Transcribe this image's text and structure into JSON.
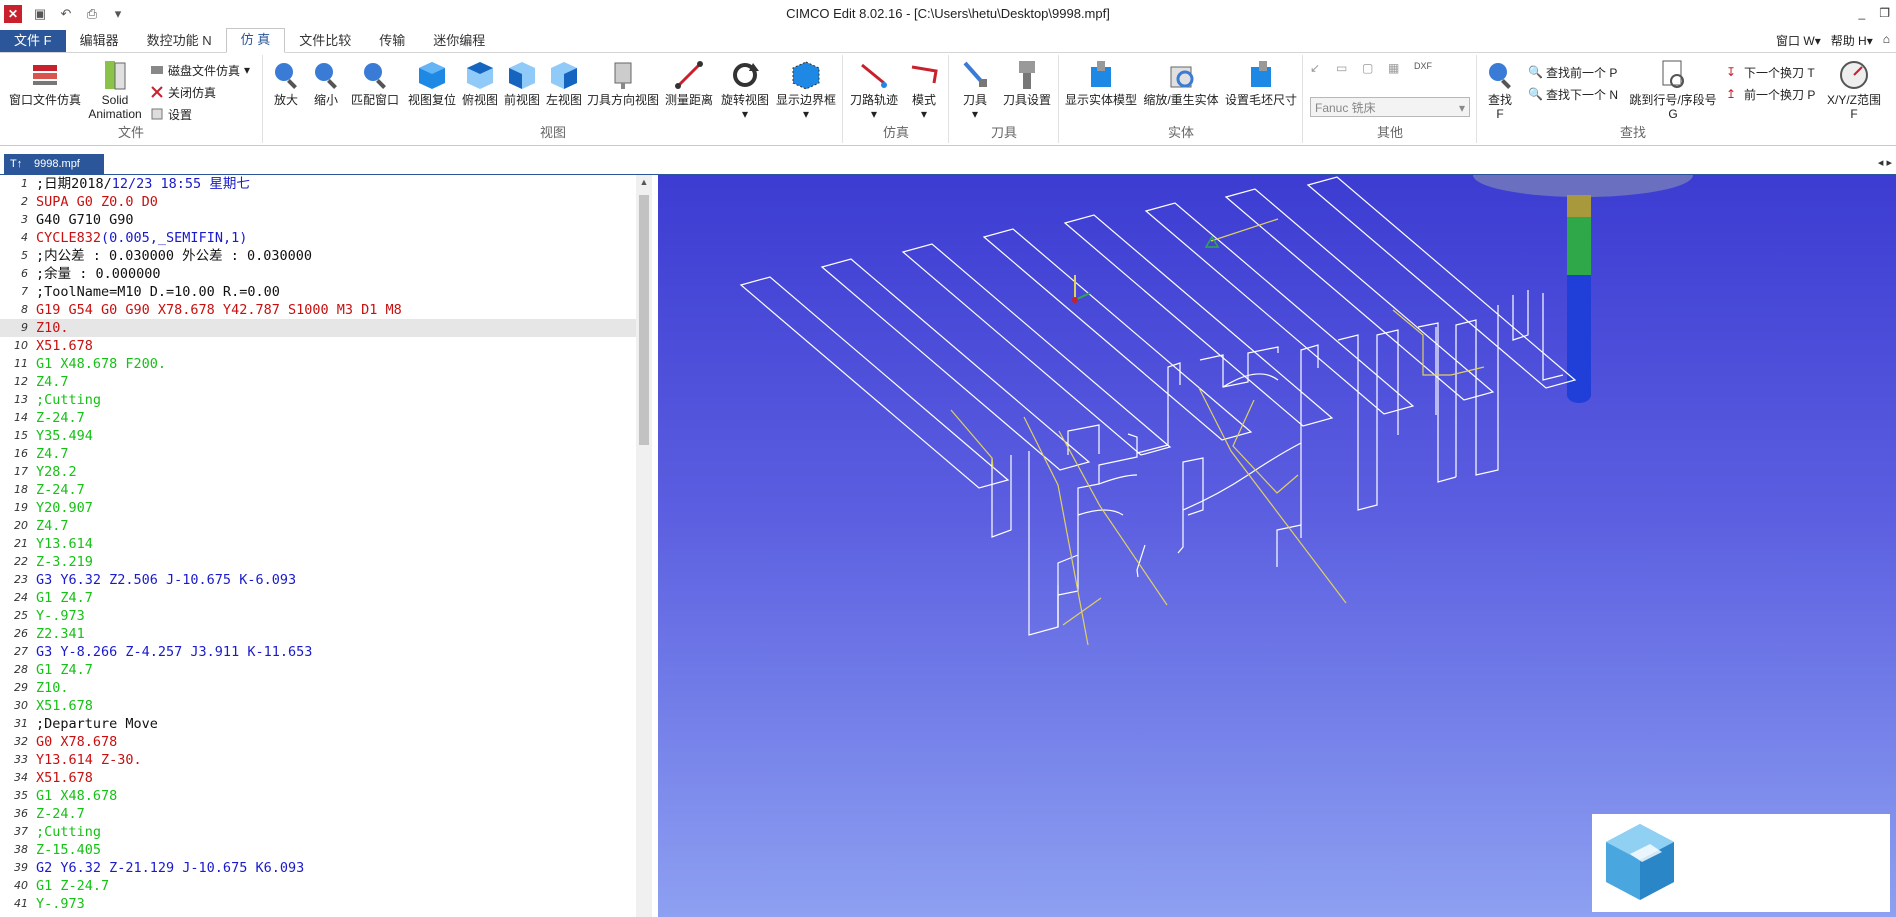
{
  "titlebar": {
    "title": "CIMCO Edit 8.02.16 - [C:\\Users\\hetu\\Desktop\\9998.mpf]",
    "minimize": "_",
    "restore": "❐"
  },
  "menubar": {
    "tabs": [
      "文件 F",
      "编辑器",
      "数控功能 N",
      "仿 真",
      "文件比较",
      "传输",
      "迷你编程"
    ],
    "active_index": 3,
    "right": [
      "窗口 W▾",
      "帮助 H▾",
      "⌂"
    ]
  },
  "ribbon": {
    "file_group": {
      "label": "文件",
      "window_sim": "窗口文件仿真",
      "solid_anim_l1": "Solid",
      "solid_anim_l2": "Animation",
      "disk_sim": "磁盘文件仿真",
      "close_sim": "关闭仿真",
      "settings": "设置"
    },
    "view_group": {
      "label": "视图",
      "buttons": [
        "放大",
        "缩小",
        "匹配窗口",
        "视图复位",
        "俯视图",
        "前视图",
        "左视图",
        "刀具方向视图",
        "测量距离",
        "旋转视图",
        "显示边界框"
      ]
    },
    "sim_group": {
      "label": "仿真",
      "buttons": [
        "刀路轨迹",
        "模式"
      ]
    },
    "tool_group": {
      "label": "刀具",
      "buttons": [
        "刀具",
        "刀具设置"
      ]
    },
    "solid_group": {
      "label": "实体",
      "buttons": [
        "显示实体模型",
        "缩放/重生实体",
        "设置毛坯尺寸"
      ]
    },
    "other_group": {
      "label": "其他",
      "machine_select": "Fanuc 铣床"
    },
    "find_group": {
      "label": "查找",
      "find_l1": "查找",
      "find_l2": "F",
      "find_prev": "查找前一个 P",
      "find_next": "查找下一个 N",
      "jump_l1": "跳到行号/序段号",
      "jump_l2": "G",
      "next_tool": "下一个换刀 T",
      "prev_tool": "前一个换刀 P",
      "xyz_l1": "X/Y/Z范围",
      "xyz_l2": "F"
    }
  },
  "doc_tab": {
    "name": "9998.mpf"
  },
  "editor": {
    "highlight_line": 9,
    "lines": [
      {
        "n": "1",
        "segs": [
          {
            "t": ";日期2018/",
            "c": "black"
          },
          {
            "t": "12/23 18:55 星期七",
            "c": "blue"
          }
        ]
      },
      {
        "n": "2",
        "segs": [
          {
            "t": "SUPA G0 Z0.0 D0",
            "c": "red"
          }
        ]
      },
      {
        "n": "3",
        "segs": [
          {
            "t": "G40 G710 G90",
            "c": "black"
          }
        ]
      },
      {
        "n": "4",
        "segs": [
          {
            "t": "CYCLE832",
            "c": "red"
          },
          {
            "t": "(0.005,_SEMIFIN,1)",
            "c": "blue"
          }
        ]
      },
      {
        "n": "5",
        "segs": [
          {
            "t": ";内公差 : 0.030000 外公差 : 0.030000",
            "c": "black"
          }
        ]
      },
      {
        "n": "6",
        "segs": [
          {
            "t": ";余量 : 0.000000",
            "c": "black"
          }
        ]
      },
      {
        "n": "7",
        "segs": [
          {
            "t": ";ToolName=M10 D.=10.00 R.=0.00",
            "c": "black"
          }
        ]
      },
      {
        "n": "8",
        "segs": [
          {
            "t": "G19 G54 G0 G90 X78.678 Y42.787 S1000 M3 D1 M8",
            "c": "red"
          }
        ]
      },
      {
        "n": "9",
        "segs": [
          {
            "t": "Z10.",
            "c": "red"
          }
        ]
      },
      {
        "n": "10",
        "segs": [
          {
            "t": "X51.678",
            "c": "red"
          }
        ]
      },
      {
        "n": "11",
        "segs": [
          {
            "t": "G1 X48.678 F200.",
            "c": "green"
          }
        ]
      },
      {
        "n": "12",
        "segs": [
          {
            "t": "Z4.7",
            "c": "green"
          }
        ]
      },
      {
        "n": "13",
        "segs": [
          {
            "t": ";Cutting",
            "c": "green"
          }
        ]
      },
      {
        "n": "14",
        "segs": [
          {
            "t": "Z-24.7",
            "c": "green"
          }
        ]
      },
      {
        "n": "15",
        "segs": [
          {
            "t": "Y35.494",
            "c": "green"
          }
        ]
      },
      {
        "n": "16",
        "segs": [
          {
            "t": "Z4.7",
            "c": "green"
          }
        ]
      },
      {
        "n": "17",
        "segs": [
          {
            "t": "Y28.2",
            "c": "green"
          }
        ]
      },
      {
        "n": "18",
        "segs": [
          {
            "t": "Z-24.7",
            "c": "green"
          }
        ]
      },
      {
        "n": "19",
        "segs": [
          {
            "t": "Y20.907",
            "c": "green"
          }
        ]
      },
      {
        "n": "20",
        "segs": [
          {
            "t": "Z4.7",
            "c": "green"
          }
        ]
      },
      {
        "n": "21",
        "segs": [
          {
            "t": "Y13.614",
            "c": "green"
          }
        ]
      },
      {
        "n": "22",
        "segs": [
          {
            "t": "Z-3.219",
            "c": "green"
          }
        ]
      },
      {
        "n": "23",
        "segs": [
          {
            "t": "G3 Y6.32 Z2.506 J-10.675 K-6.093",
            "c": "blue"
          }
        ]
      },
      {
        "n": "24",
        "segs": [
          {
            "t": "G1 Z4.7",
            "c": "green"
          }
        ]
      },
      {
        "n": "25",
        "segs": [
          {
            "t": "Y-.973",
            "c": "green"
          }
        ]
      },
      {
        "n": "26",
        "segs": [
          {
            "t": "Z2.341",
            "c": "green"
          }
        ]
      },
      {
        "n": "27",
        "segs": [
          {
            "t": "G3 Y-8.266 Z-4.257 J3.911 K-11.653",
            "c": "blue"
          }
        ]
      },
      {
        "n": "28",
        "segs": [
          {
            "t": "G1 Z4.7",
            "c": "green"
          }
        ]
      },
      {
        "n": "29",
        "segs": [
          {
            "t": "Z10.",
            "c": "green"
          }
        ]
      },
      {
        "n": "30",
        "segs": [
          {
            "t": "X51.678",
            "c": "green"
          }
        ]
      },
      {
        "n": "31",
        "segs": [
          {
            "t": ";Departure Move",
            "c": "black"
          }
        ]
      },
      {
        "n": "32",
        "segs": [
          {
            "t": "G0 X78.678",
            "c": "red"
          }
        ]
      },
      {
        "n": "33",
        "segs": [
          {
            "t": "Y13.614 Z-30.",
            "c": "red"
          }
        ]
      },
      {
        "n": "34",
        "segs": [
          {
            "t": "X51.678",
            "c": "red"
          }
        ]
      },
      {
        "n": "35",
        "segs": [
          {
            "t": "G1 X48.678",
            "c": "green"
          }
        ]
      },
      {
        "n": "36",
        "segs": [
          {
            "t": "Z-24.7",
            "c": "green"
          }
        ]
      },
      {
        "n": "37",
        "segs": [
          {
            "t": ";Cutting",
            "c": "green"
          }
        ]
      },
      {
        "n": "38",
        "segs": [
          {
            "t": "Z-15.405",
            "c": "green"
          }
        ]
      },
      {
        "n": "39",
        "segs": [
          {
            "t": "G2 Y6.32 Z-21.129 J-10.675 K6.093",
            "c": "blue"
          }
        ]
      },
      {
        "n": "40",
        "segs": [
          {
            "t": "G1 Z-24.7",
            "c": "green"
          }
        ]
      },
      {
        "n": "41",
        "segs": [
          {
            "t": "Y-.973",
            "c": "green"
          }
        ]
      }
    ]
  },
  "colors": {
    "brand_blue": "#2b579a",
    "code_red": "#c81010",
    "code_green": "#15c115",
    "code_blue": "#1a1acd",
    "viewport_top": "#3c3cd2",
    "viewport_bottom": "#8da0f1",
    "rapid_path": "#e0d060",
    "feed_path": "#ffffff"
  }
}
